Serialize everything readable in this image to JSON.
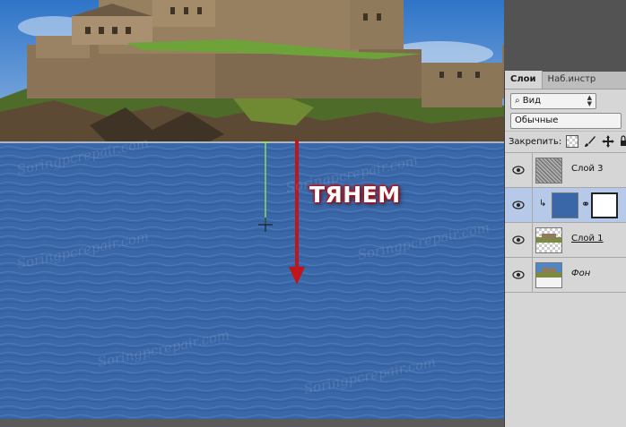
{
  "annotation": {
    "text": "ТЯНЕМ",
    "color": "#c0151b"
  },
  "watermark": {
    "text": "Soringpcrepair.com"
  },
  "panel": {
    "tabs": [
      {
        "label": "Слои",
        "active": true
      },
      {
        "label": "Наб.инстр",
        "active": false
      }
    ],
    "filter_dropdown": {
      "icon": "search-icon",
      "value": "Вид"
    },
    "blend_dropdown": {
      "value": "Обычные"
    },
    "lock_label": "Закрепить:",
    "lock_icons": [
      "lock-transparent-icon",
      "brush-icon",
      "move-icon",
      "lock-icon"
    ],
    "layers": [
      {
        "name": "Слой 3",
        "thumb": "noise",
        "selected": false,
        "visible": true
      },
      {
        "name": "",
        "thumb": "fill-blue",
        "mask": true,
        "clipped": true,
        "selected": true,
        "visible": true
      },
      {
        "name": "Слой 1",
        "thumb": "castle-transparent",
        "selected": false,
        "visible": true,
        "underline": true
      },
      {
        "name": "Фон",
        "thumb": "castle",
        "selected": false,
        "visible": true,
        "italic": true
      }
    ]
  },
  "colors": {
    "water": "#3a67a8",
    "panel_bg": "#d6d6d6",
    "selected_layer": "#b7c9e8",
    "gradient_line": "#9ae05a"
  }
}
